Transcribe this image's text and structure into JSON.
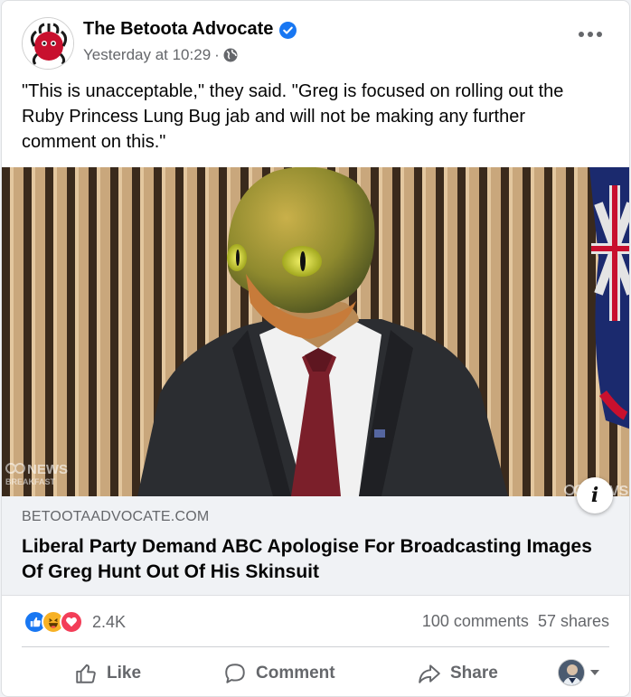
{
  "post": {
    "page_name": "The Betoota Advocate",
    "timestamp": "Yesterday at 10:29",
    "separator": "·",
    "text": "\"This is unacceptable,\" they said. \"Greg is focused on rolling out the Ruby Princess Lung Bug jab and will not be making any further comment on this.\""
  },
  "image": {
    "watermark_left": "NEWS",
    "watermark_left_sub": "BREAKFAST",
    "watermark_right": "VS"
  },
  "link": {
    "domain": "BETOOTAADVOCATE.COM",
    "title": "Liberal Party Demand ABC Apologise For Broadcasting Images Of Greg Hunt Out Of His Skinsuit"
  },
  "engagement": {
    "reaction_count": "2.4K",
    "comments": "100 comments",
    "shares": "57 shares"
  },
  "actions": {
    "like": "Like",
    "comment": "Comment",
    "share": "Share"
  },
  "colors": {
    "facebook_blue": "#1877f2",
    "like_blue": "#1877f2",
    "haha_yellow": "#f7b125",
    "love_red": "#f33e58",
    "muted_text": "#65676b"
  }
}
